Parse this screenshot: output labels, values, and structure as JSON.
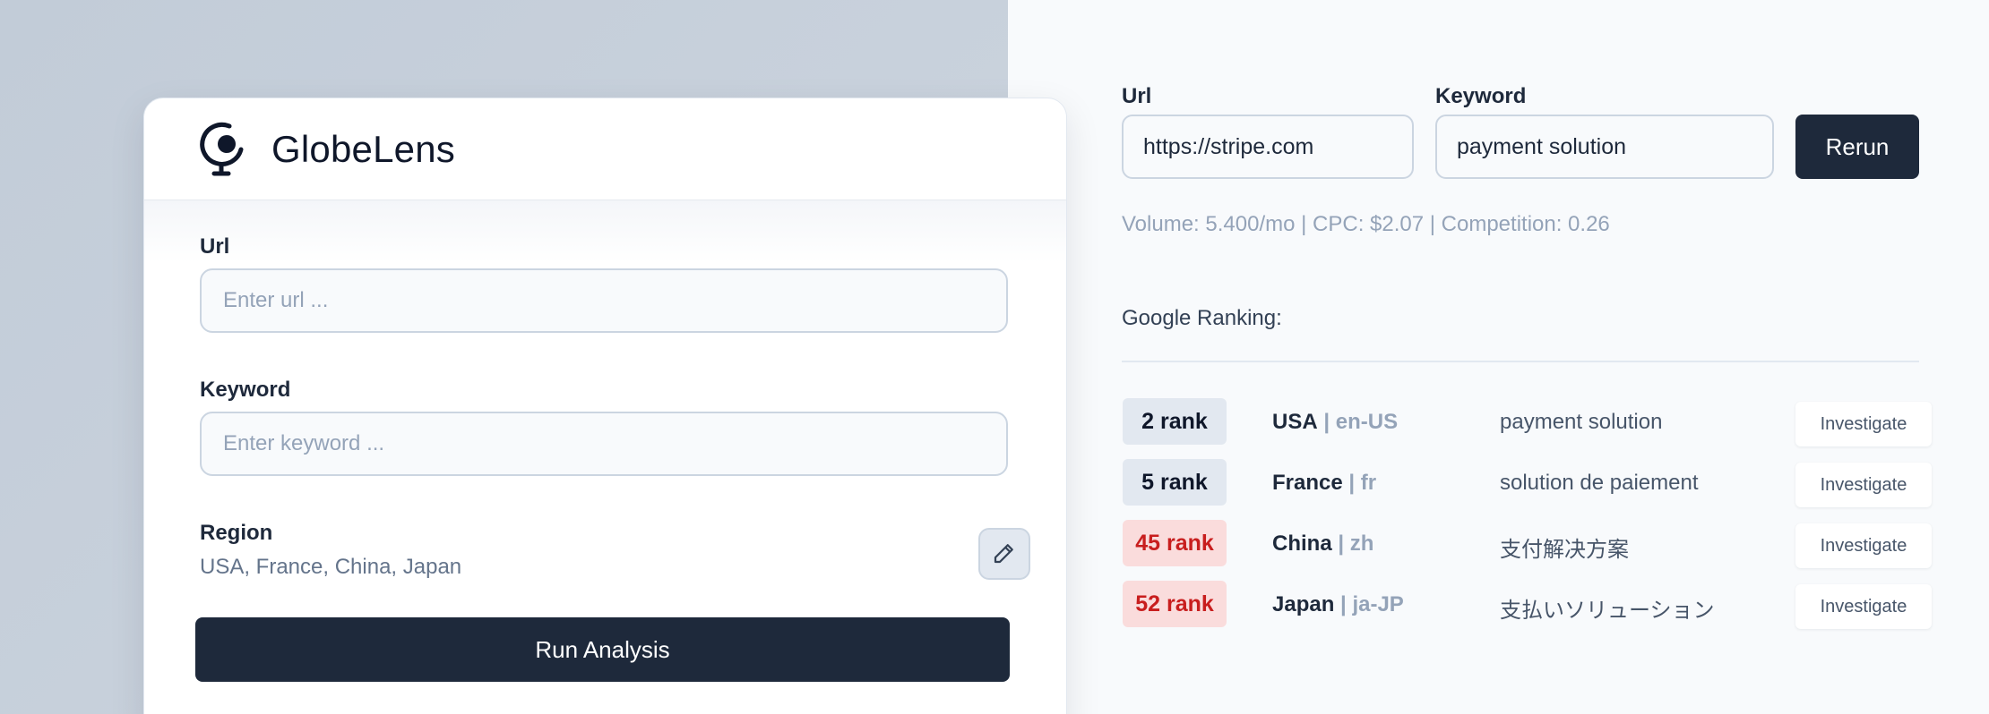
{
  "app": {
    "brand_name": "GlobeLens",
    "logo_icon": "globe-lens-icon"
  },
  "form": {
    "url_label": "Url",
    "url_placeholder": "Enter url ...",
    "url_value": "",
    "keyword_label": "Keyword",
    "keyword_placeholder": "Enter keyword ...",
    "keyword_value": "",
    "region_label": "Region",
    "region_value": "USA, France, China, Japan",
    "edit_icon": "pencil-icon",
    "run_label": "Run Analysis"
  },
  "results": {
    "url_label": "Url",
    "url_value": "https://stripe.com",
    "keyword_label": "Keyword",
    "keyword_value": "payment solution",
    "rerun_label": "Rerun",
    "stats": "Volume: 5.400/mo | CPC: $2.07 | Competition: 0.26",
    "ranking_title": "Google Ranking:",
    "separator": "|",
    "rows": [
      {
        "rank": "2 rank",
        "status": "good",
        "country": "USA",
        "lang": "en-US",
        "keyword": "payment solution",
        "action": "Investigate"
      },
      {
        "rank": "5 rank",
        "status": "good",
        "country": "France",
        "lang": "fr",
        "keyword": "solution de paiement",
        "action": "Investigate"
      },
      {
        "rank": "45 rank",
        "status": "bad",
        "country": "China",
        "lang": "zh",
        "keyword": "支付解决方案",
        "action": "Investigate"
      },
      {
        "rank": "52 rank",
        "status": "bad",
        "country": "Japan",
        "lang": "ja-JP",
        "keyword": "支払いソリューション",
        "action": "Investigate"
      }
    ]
  },
  "colors": {
    "primary": "#1e293b",
    "badge_good_bg": "#e2e8f0",
    "badge_bad_bg": "#fadcdc",
    "badge_bad_text": "#c81e1e",
    "muted_text": "#94a3b8"
  }
}
